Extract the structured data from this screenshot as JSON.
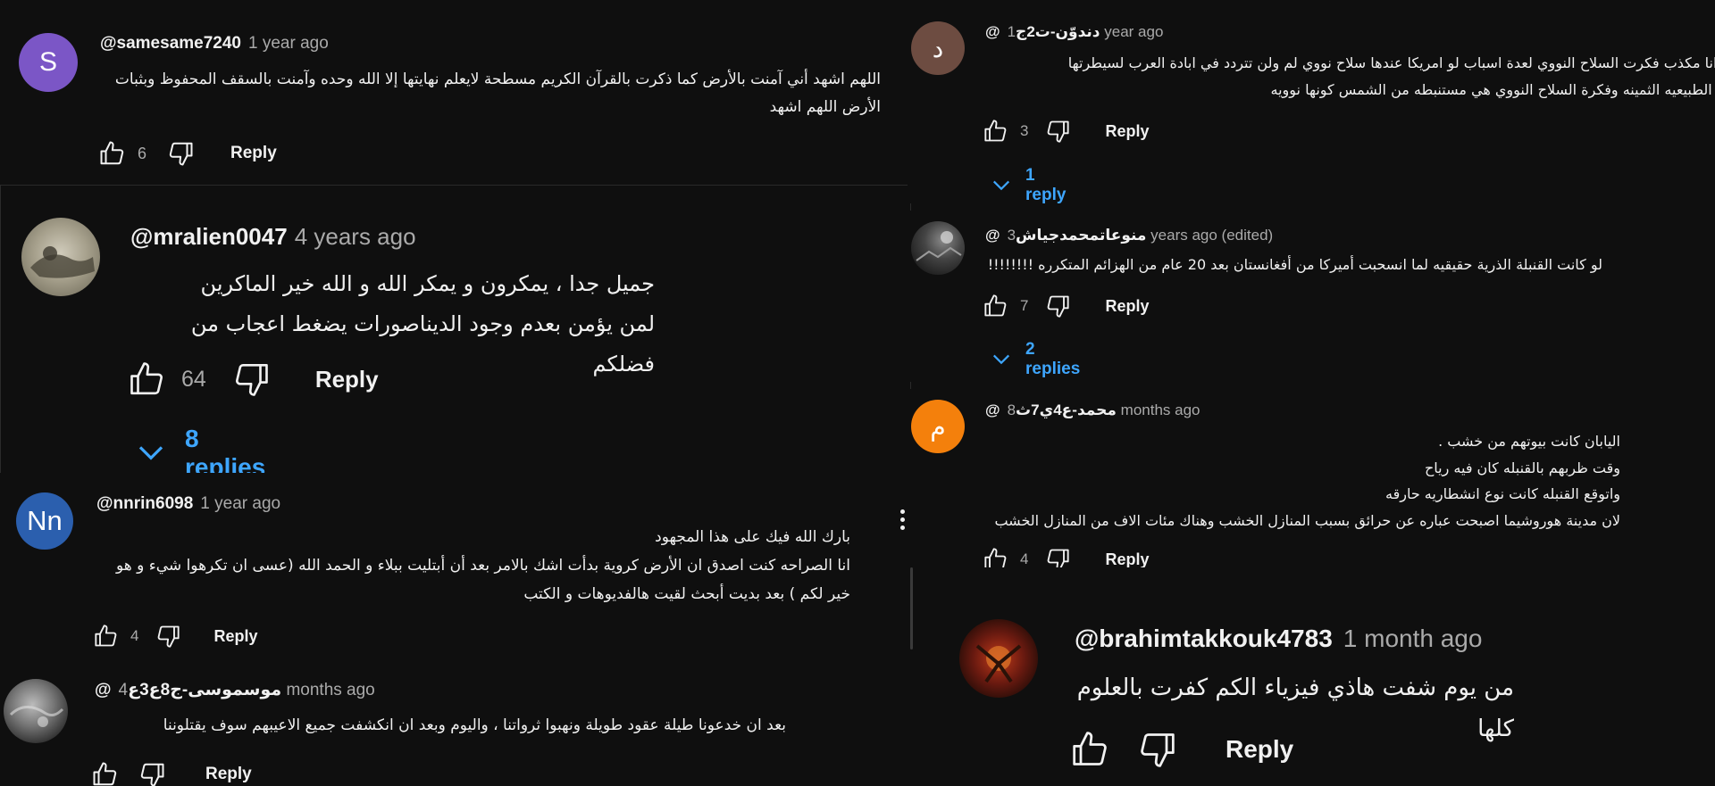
{
  "comments": {
    "c1": {
      "avatar_letter": "S",
      "author": "@samesame7240",
      "time": "1 year ago",
      "text": "اللهم اشهد أني آمنت بالأرض كما ذكرت بالقرآن الكريم مسطحة لايعلم نهايتها إلا الله وحده وآمنت بالسقف المحفوظ وبثبات\nالأرض اللهم اشهد",
      "likes": "6",
      "reply": "Reply"
    },
    "c2": {
      "author": "@mralien0047",
      "time": "4 years ago",
      "text": "جميل جدا ، يمكرون و يمكر الله و الله خير الماكرين\nلمن يؤمن بعدم وجود الديناصورات يضغط اعجاب من فضلكم",
      "likes": "64",
      "reply": "Reply",
      "replies": "8 replies"
    },
    "c3": {
      "avatar_letter": "Nn",
      "author": "@nnrin6098",
      "time": "1 year ago",
      "text": "بارك الله فيك على هذا المجهود\nانا الصراحه كنت اصدق ان الأرض كروية بدأت اشك بالامر بعد أن أبتليت ببلاء و الحمد الله (عسى ان تكرهوا شيء و هو\nخير لكم ) بعد بديت أبحث لقيت هالفديوهات و الكتب",
      "likes": "4",
      "reply": "Reply"
    },
    "c4": {
      "author": "@موسموسی-ج8ع3ع",
      "time": "4 months ago",
      "text": "بعد ان خدعونا طيلة عقود طويلة ونهبوا ثرواتنا ، واليوم وبعد ان انكشفت جميع الاعيبهم سوف يقتلوننا",
      "reply": "Reply"
    },
    "c5": {
      "avatar_letter": "د",
      "author": "@دندوّن-ت2ج",
      "time": "1 year ago",
      "text": "من زمان وانا مكذب فكرت السلاح النووي لعدة اسباب لو امريكا عندها سلاح نووي لم ولن تتردد في ابادة العرب لسيطرتها\nعلى الموار الطبيعيه الثمينه وفكرة السلاح النووي هي مستنبطه من الشمس كونها نوويه",
      "likes": "3",
      "reply": "Reply",
      "replies": "1 reply"
    },
    "c6": {
      "author": "@منوعاتمحمدجياش",
      "time": "3 years ago (edited)",
      "text": "لو كانت القنبلة الذرية حقيقيه لما انسحبت أميركا من أفغانستان بعد 20 عام من الهزائم المتكرره !!!!!!!!",
      "likes": "7",
      "reply": "Reply",
      "replies": "2 replies"
    },
    "c7": {
      "avatar_letter": "م",
      "author": "@محمد-ع4ي7ث",
      "time": "8 months ago",
      "text": "اليابان كانت بيوتهم من خشب .\nوقت ظربهم بالقنبله كان فيه رياح\nواتوقع القنبله كانت نوع انشطاريه حارقه\nلان مدينة هوروشيما اصبحت عباره عن حرائق بسبب المنازل الخشب وهناك مئات الاف من المنازل الخشب",
      "likes": "4",
      "reply": "Reply"
    },
    "c8": {
      "author": "@brahimtakkouk4783",
      "time": "1 month ago",
      "text": "من يوم شفت هاذي فيزياء الكم كفرت بالعلوم كلها",
      "reply": "Reply"
    }
  },
  "colors": {
    "background": "#0f0f0f",
    "link_blue": "#3ea6ff",
    "muted": "#aaaaaa"
  },
  "icons": [
    "like-icon",
    "dislike-icon",
    "chevron-down-icon",
    "more-vert-icon"
  ]
}
